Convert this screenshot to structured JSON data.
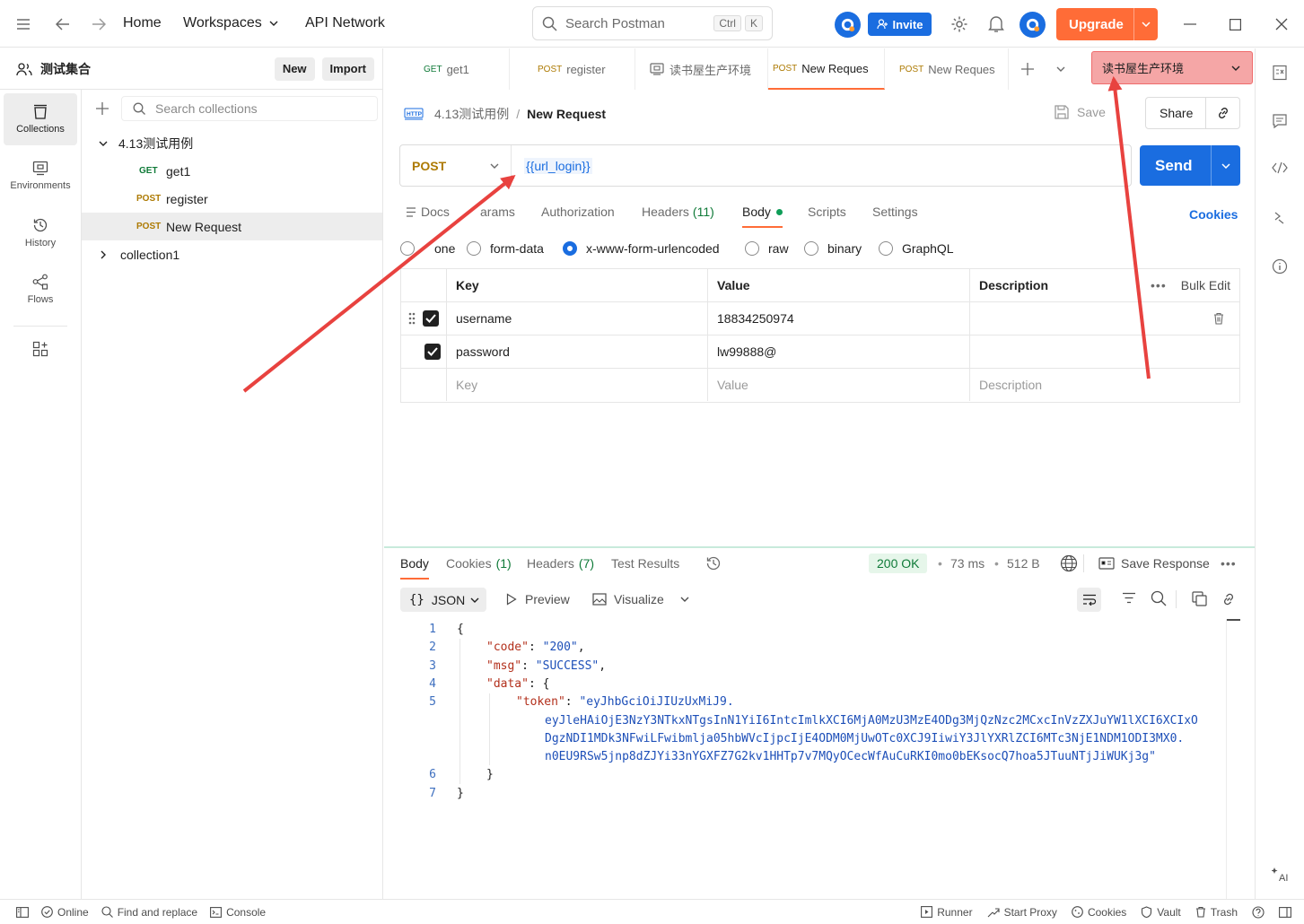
{
  "topbar": {
    "nav_home": "Home",
    "nav_workspaces": "Workspaces",
    "nav_api_network": "API Network",
    "search_placeholder": "Search Postman",
    "search_shortcut_1": "Ctrl",
    "search_shortcut_2": "K",
    "invite_label": "Invite",
    "upgrade_label": "Upgrade"
  },
  "workspace": {
    "name": "测试集合",
    "new_label": "New",
    "import_label": "Import"
  },
  "leftnav": {
    "items": [
      {
        "label": "Collections",
        "icon": "trash-bin-icon"
      },
      {
        "label": "Environments",
        "icon": "environment-icon"
      },
      {
        "label": "History",
        "icon": "history-icon"
      },
      {
        "label": "Flows",
        "icon": "flows-icon"
      }
    ]
  },
  "sidebar": {
    "search_placeholder": "Search collections",
    "collection1_name": "4.13测试用例",
    "requests": [
      {
        "method": "GET",
        "name": "get1"
      },
      {
        "method": "POST",
        "name": "register"
      },
      {
        "method": "POST",
        "name": "New Request"
      }
    ],
    "collection2_name": "collection1"
  },
  "tabs": [
    {
      "method": "GET",
      "name": "get1"
    },
    {
      "method": "POST",
      "name": "register"
    },
    {
      "method": "",
      "name": "读书屋生产环境"
    },
    {
      "method": "POST",
      "name": "New Reques"
    },
    {
      "method": "POST",
      "name": "New Reques"
    }
  ],
  "environment": {
    "selected": "读书屋生产环境"
  },
  "request": {
    "breadcrumb_parent": "4.13测试用例",
    "breadcrumb_sep": "/",
    "breadcrumb_current": "New Request",
    "save_label": "Save",
    "share_label": "Share",
    "method": "POST",
    "url": "{{url_login}}",
    "send_label": "Send",
    "subtabs": {
      "docs": "Docs",
      "params": "arams",
      "authorization": "Authorization",
      "headers": "Headers",
      "headers_count": "(11)",
      "body": "Body",
      "scripts": "Scripts",
      "settings": "Settings",
      "cookies": "Cookies"
    },
    "body_types": {
      "none": "one",
      "form_data": "form-data",
      "urlencoded": "x-www-form-urlencoded",
      "raw": "raw",
      "binary": "binary",
      "graphql": "GraphQL"
    },
    "table": {
      "col_key": "Key",
      "col_value": "Value",
      "col_description": "Description",
      "bulk_edit": "Bulk Edit",
      "rows": [
        {
          "key": "username",
          "value": "18834250974",
          "description": ""
        },
        {
          "key": "password",
          "value": "lw99888@",
          "description": ""
        }
      ],
      "placeholder_key": "Key",
      "placeholder_value": "Value",
      "placeholder_description": "Description"
    }
  },
  "response": {
    "tabs": {
      "body": "Body",
      "cookies": "Cookies",
      "cookies_count": "(1)",
      "headers": "Headers",
      "headers_count": "(7)",
      "test_results": "Test Results"
    },
    "status": "200 OK",
    "time": "73 ms",
    "size": "512 B",
    "save_response": "Save Response",
    "format": "JSON",
    "preview": "Preview",
    "visualize": "Visualize",
    "lines": {
      "l1_brace": "{",
      "code_key": "\"code\"",
      "code_val": "\"200\"",
      "msg_key": "\"msg\"",
      "msg_val": "\"SUCCESS\"",
      "data_key": "\"data\"",
      "token_key": "\"token\"",
      "token_l1": "\"eyJhbGciOiJIUzUxMiJ9.",
      "token_l2": "eyJleHAiOjE3NzY3NTkxNTgsInN1YiI6IntcImlkXCI6MjA0MzU3MzE4ODg3MjQzNzc2MCxcInVzZXJuYW1lXCI6XCIxO",
      "token_l3": "DgzNDI1MDk3NFwiLFwibmlja05hbWVcIjpcIjE4ODM0MjUwOTc0XCJ9IiwiY3JlYXRlZCI6MTc3NjE1NDM1ODI3MX0.",
      "token_l4": "n0EU9RSw5jnp8dZJYi33nYGXFZ7G2kv1HHTp7v7MQyOCecWfAuCuRKI0mo0bEKsocQ7hoa5JTuuNTjJiWUKj3g\"",
      "close_inner": "}",
      "close_outer": "}"
    }
  },
  "footer": {
    "online": "Online",
    "find_replace": "Find and replace",
    "console": "Console",
    "runner": "Runner",
    "start_proxy": "Start Proxy",
    "cookies": "Cookies",
    "vault": "Vault",
    "trash": "Trash"
  },
  "colors": {
    "accent_orange": "#ff6c37",
    "primary_blue": "#1a6de0",
    "annotation_arrow": "#e8423f",
    "env_highlight": "#f5a6a6"
  }
}
